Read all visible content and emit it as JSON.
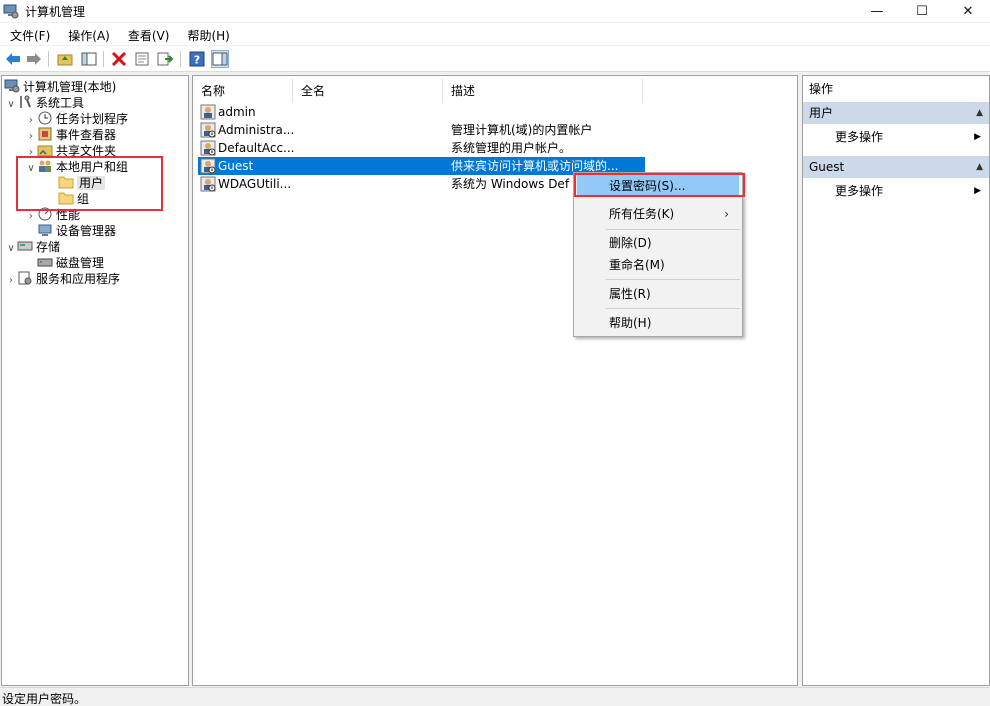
{
  "window": {
    "title": "计算机管理",
    "minimize_glyph": "—",
    "maximize_glyph": "☐",
    "close_glyph": "✕"
  },
  "menu": [
    "文件(F)",
    "操作(A)",
    "查看(V)",
    "帮助(H)"
  ],
  "toolbar": {
    "icons": [
      "back-icon",
      "forward-icon",
      "up-folder-icon",
      "show-hide-tree-icon",
      "delete-icon",
      "properties-icon",
      "export-list-icon",
      "help-icon",
      "show-hide-action-pane-icon"
    ]
  },
  "tree": {
    "root": "计算机管理(本地)",
    "system_tools": "系统工具",
    "task_scheduler": "任务计划程序",
    "event_viewer": "事件查看器",
    "shared_folders": "共享文件夹",
    "local_users_groups": "本地用户和组",
    "users": "用户",
    "groups": "组",
    "performance": "性能",
    "device_manager": "设备管理器",
    "storage": "存储",
    "disk_management": "磁盘管理",
    "services_apps": "服务和应用程序"
  },
  "list": {
    "columns": [
      "名称",
      "全名",
      "描述"
    ],
    "rows": [
      {
        "name": "admin",
        "fullname": "",
        "desc": ""
      },
      {
        "name": "Administra...",
        "fullname": "",
        "desc": "管理计算机(域)的内置帐户"
      },
      {
        "name": "DefaultAcc...",
        "fullname": "",
        "desc": "系统管理的用户帐户。"
      },
      {
        "name": "Guest",
        "fullname": "",
        "desc": "供来宾访问计算机或访问域的..."
      },
      {
        "name": "WDAGUtili...",
        "fullname": "",
        "desc": "系统为 Windows Def"
      }
    ]
  },
  "context_menu": {
    "set_password": "设置密码(S)...",
    "all_tasks": "所有任务(K)",
    "submenu_glyph": "›",
    "delete": "删除(D)",
    "rename": "重命名(M)",
    "properties": "属性(R)",
    "help": "帮助(H)"
  },
  "actions": {
    "title": "操作",
    "section1": "用户",
    "section1_more": "更多操作",
    "section2": "Guest",
    "section2_more": "更多操作",
    "submenu_glyph": "▶",
    "collapse_glyph": "▲"
  },
  "status": "设定用户密码。",
  "colors": {
    "selection": "#0078d7",
    "menu_highlight": "#91c9f7",
    "annotation_red": "#e8303c",
    "section_header": "#cbd9e8"
  }
}
